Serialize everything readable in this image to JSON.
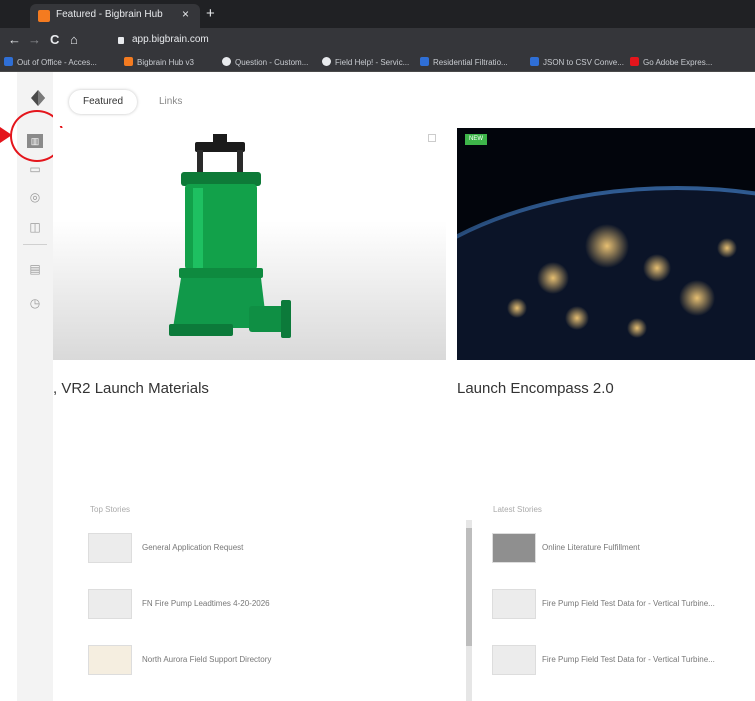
{
  "browser": {
    "tab_title": "Featured - Bigbrain Hub",
    "tab_close": "×",
    "new_tab": "+",
    "url": "app.bigbrain.com",
    "back": "←",
    "forward": "→",
    "reload": "C",
    "home": "⌂",
    "bookmarks": [
      {
        "label": "Out of Office - Acces...",
        "color": "#2f6fd6"
      },
      {
        "label": "Bigbrain Hub v3",
        "color": "#f47b20"
      },
      {
        "label": "Question - Custom...",
        "color": "#e8eaed"
      },
      {
        "label": "Field Help! - Servic...",
        "color": "#e8eaed"
      },
      {
        "label": "Residential Filtratio...",
        "color": "#2f6fd6"
      },
      {
        "label": "JSON to CSV Conve...",
        "color": "#2f6fd6"
      },
      {
        "label": "Go Adobe Expres...",
        "color": "#e4151c"
      }
    ]
  },
  "nav": {
    "tabs": [
      {
        "label": "Featured",
        "active": true
      },
      {
        "label": "Links",
        "active": false
      }
    ]
  },
  "sidebar": {
    "icons": [
      "logo-icon",
      "home-icon",
      "calendar-icon",
      "globe-icon",
      "bag-icon",
      "newspaper-icon",
      "clock-icon"
    ]
  },
  "annotation": {
    "color": "#e4151c"
  },
  "featured": [
    {
      "title": "VR2 Launch Materials",
      "prefix": ","
    },
    {
      "title": "Launch Encompass 2.0",
      "badge": "NEW"
    }
  ],
  "top_stories": {
    "label": "Top Stories",
    "items": [
      {
        "title": "General Application Request"
      },
      {
        "title": "FN Fire Pump Leadtimes 4-20-2026"
      },
      {
        "title": "North Aurora Field Support Directory"
      }
    ]
  },
  "latest_stories": {
    "label": "Latest Stories",
    "items": [
      {
        "title": "Online Literature Fulfillment"
      },
      {
        "title": "Fire Pump Field Test Data for - Vertical Turbine..."
      },
      {
        "title": "Fire Pump Field Test Data for - Vertical Turbine..."
      }
    ]
  }
}
